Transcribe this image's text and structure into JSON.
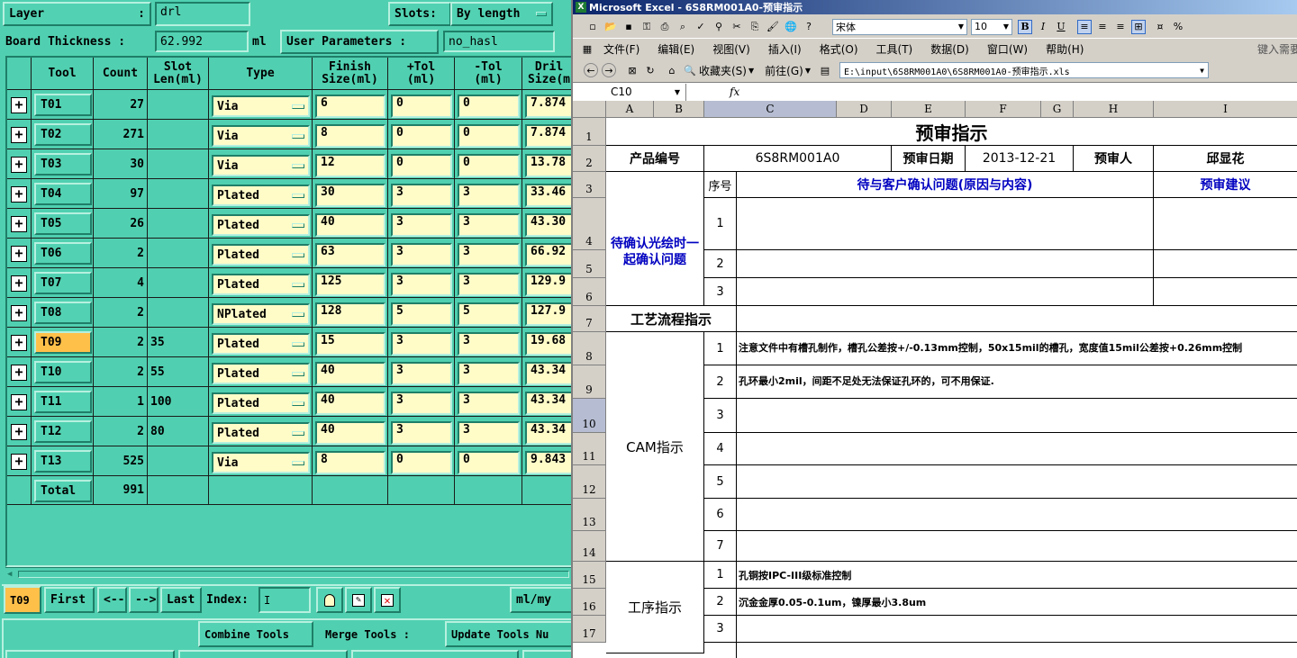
{
  "left_panel": {
    "layer_label": "Layer",
    "layer_value": "drl",
    "slots_label": "Slots:",
    "slots_value": "By length",
    "board_thickness_label": "Board Thickness :",
    "board_thickness_value": "62.992",
    "board_thickness_unit": "ml",
    "user_params_label": "User Parameters :",
    "user_params_value": "no_hasl",
    "headers": [
      "Tool",
      "Count",
      "Slot\nLen(ml)",
      "Type",
      "Finish\nSize(ml)",
      "+Tol\n(ml)",
      "-Tol\n(ml)",
      "Dril\nSize(m"
    ],
    "rows": [
      {
        "tool": "T01",
        "count": "27",
        "slot": "",
        "type": "Via",
        "finish": "6",
        "ptol": "0",
        "mtol": "0",
        "drill": "7.874"
      },
      {
        "tool": "T02",
        "count": "271",
        "slot": "",
        "type": "Via",
        "finish": "8",
        "ptol": "0",
        "mtol": "0",
        "drill": "7.874"
      },
      {
        "tool": "T03",
        "count": "30",
        "slot": "",
        "type": "Via",
        "finish": "12",
        "ptol": "0",
        "mtol": "0",
        "drill": "13.78"
      },
      {
        "tool": "T04",
        "count": "97",
        "slot": "",
        "type": "Plated",
        "finish": "30",
        "ptol": "3",
        "mtol": "3",
        "drill": "33.46"
      },
      {
        "tool": "T05",
        "count": "26",
        "slot": "",
        "type": "Plated",
        "finish": "40",
        "ptol": "3",
        "mtol": "3",
        "drill": "43.30"
      },
      {
        "tool": "T06",
        "count": "2",
        "slot": "",
        "type": "Plated",
        "finish": "63",
        "ptol": "3",
        "mtol": "3",
        "drill": "66.92"
      },
      {
        "tool": "T07",
        "count": "4",
        "slot": "",
        "type": "Plated",
        "finish": "125",
        "ptol": "3",
        "mtol": "3",
        "drill": "129.9"
      },
      {
        "tool": "T08",
        "count": "2",
        "slot": "",
        "type": "NPlated",
        "finish": "128",
        "ptol": "5",
        "mtol": "5",
        "drill": "127.9"
      },
      {
        "tool": "T09",
        "count": "2",
        "slot": "35",
        "type": "Plated",
        "finish": "15",
        "ptol": "3",
        "mtol": "3",
        "drill": "19.68"
      },
      {
        "tool": "T10",
        "count": "2",
        "slot": "55",
        "type": "Plated",
        "finish": "40",
        "ptol": "3",
        "mtol": "3",
        "drill": "43.34"
      },
      {
        "tool": "T11",
        "count": "1",
        "slot": "100",
        "type": "Plated",
        "finish": "40",
        "ptol": "3",
        "mtol": "3",
        "drill": "43.34"
      },
      {
        "tool": "T12",
        "count": "2",
        "slot": "80",
        "type": "Plated",
        "finish": "40",
        "ptol": "3",
        "mtol": "3",
        "drill": "43.34"
      },
      {
        "tool": "T13",
        "count": "525",
        "slot": "",
        "type": "Via",
        "finish": "8",
        "ptol": "0",
        "mtol": "0",
        "drill": "9.843"
      }
    ],
    "total_label": "Total",
    "total_count": "991",
    "current_tool": "T09",
    "nav": {
      "first": "First",
      "prev": "<--",
      "next": "-->",
      "last": "Last",
      "index_label": "Index:",
      "unit": "ml/my"
    },
    "actions": {
      "combine": "Combine Tools",
      "merge_label": "Merge Tools :",
      "update": "Update Tools Nu"
    },
    "accent_color": "#ffc04a"
  },
  "excel": {
    "title": "Microsoft Excel - 6S8RM001A0-预审指示",
    "font_name": "宋体",
    "font_size": "10",
    "menu": [
      "文件(F)",
      "编辑(E)",
      "视图(V)",
      "插入(I)",
      "格式(O)",
      "工具(T)",
      "数据(D)",
      "窗口(W)",
      "帮助(H)"
    ],
    "help_box": "键入需要",
    "web_toolbar": {
      "favorites": "收藏夹(S)",
      "goto": "前往(G)",
      "path": "E:\\input\\6S8RM001A0\\6S8RM001A0-预审指示.xls"
    },
    "name_box": "C10",
    "fx": "fx",
    "columns": [
      "A",
      "B",
      "C",
      "D",
      "E",
      "F",
      "G",
      "H",
      "I"
    ],
    "rows": [
      "1",
      "2",
      "3",
      "4",
      "5",
      "6",
      "7",
      "8",
      "9",
      "10",
      "11",
      "12",
      "13",
      "14",
      "15",
      "16",
      "17"
    ],
    "cells": {
      "title": "预审指示",
      "product_no_label": "产品编号",
      "product_no": "6S8RM001A0",
      "review_date_label": "预审日期",
      "review_date": "2013-12-21",
      "reviewer_label": "预审人",
      "reviewer": "邱显花",
      "seq_label": "序号",
      "question_header": "待与客户确认问题(原因与内容)",
      "suggest_header": "预审建议",
      "confirm_label": "待确认光绘时一起确认问题",
      "process_flow": "工艺流程指示",
      "cam_label": "CAM指示",
      "cam_1": "注意文件中有槽孔制作，槽孔公差按+/-0.13mm控制，50x15mil的槽孔，宽度值15mil公差按+0.26mm控制",
      "cam_2": "孔环最小2mil，间距不足处无法保证孔环的，可不用保证.",
      "proc_label": "工序指示",
      "proc_1": "孔铜按IPC-III级标准控制",
      "proc_2": "沉金金厚0.05-0.1um，镍厚最小3.8um",
      "n1": "1",
      "n2": "2",
      "n3": "3",
      "n4": "4",
      "n5": "5",
      "n6": "6",
      "n7": "7"
    }
  }
}
